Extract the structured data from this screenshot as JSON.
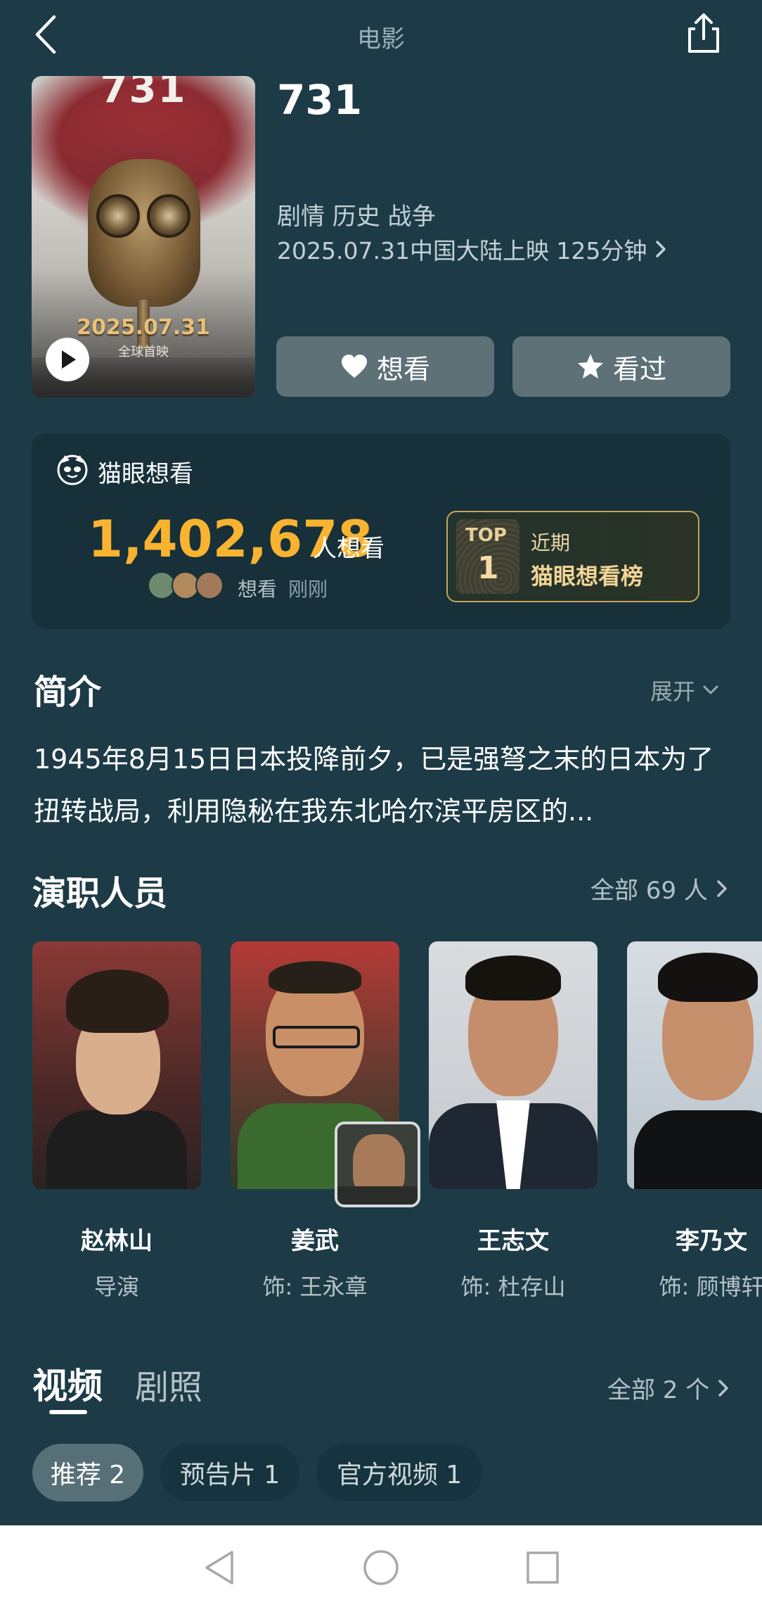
{
  "header": {
    "title": "电影"
  },
  "movie": {
    "poster": {
      "title": "731",
      "date": "2025.07.31",
      "subtitle": "全球首映"
    },
    "title": "731",
    "genres": "剧情 历史 战争",
    "release_info": "2025.07.31中国大陆上映 125分钟"
  },
  "actions": {
    "want_label": "想看",
    "seen_label": "看过"
  },
  "want_card": {
    "title": "猫眼想看",
    "count": "1,402,678",
    "count_suffix": "人想看",
    "recent_action": "想看",
    "recent_time": "刚刚",
    "rank": {
      "top_label": "TOP",
      "number": "1",
      "period": "近期",
      "list_name": "猫眼想看榜"
    }
  },
  "synopsis": {
    "heading": "简介",
    "expand_label": "展开",
    "text": "1945年8月15日日本投降前夕，已是强弩之末的日本为了扭转战局，利用隐秘在我东北哈尔滨平房区的..."
  },
  "cast": {
    "heading": "演职人员",
    "all_label": "全部 69 人",
    "members": [
      {
        "name": "赵林山",
        "role": "导演"
      },
      {
        "name": "姜武",
        "role": "饰: 王永章"
      },
      {
        "name": "王志文",
        "role": "饰: 杜存山"
      },
      {
        "name": "李乃文",
        "role": "饰: 顾博轩"
      }
    ]
  },
  "media": {
    "tabs": [
      {
        "label": "视频",
        "active": true
      },
      {
        "label": "剧照",
        "active": false
      }
    ],
    "all_label": "全部 2 个",
    "chips": [
      {
        "label": "推荐 2",
        "active": true
      },
      {
        "label": "预告片 1",
        "active": false
      },
      {
        "label": "官方视频 1",
        "active": false
      }
    ]
  },
  "colors": {
    "background": "#1d3b47",
    "card": "#17303a",
    "accent_count": "#f8b330",
    "gold": "#c5a35a",
    "button": "#5d7177"
  },
  "icons": [
    "back-arrow-icon",
    "share-icon",
    "play-icon",
    "heart-icon",
    "star-icon",
    "cat-eye-logo-icon",
    "chevron-right-icon",
    "chevron-down-icon",
    "nav-back-icon",
    "nav-home-icon",
    "nav-recents-icon"
  ]
}
